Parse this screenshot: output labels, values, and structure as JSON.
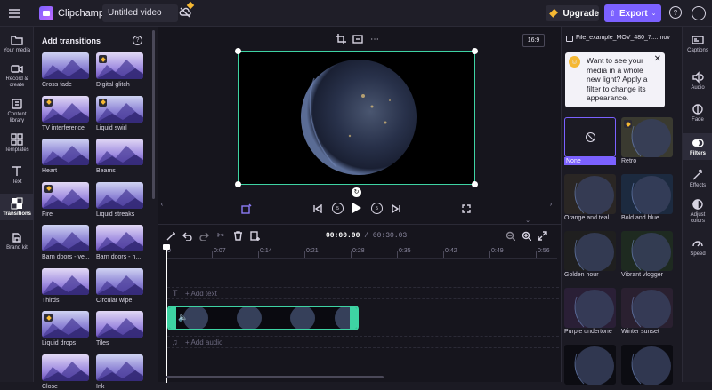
{
  "app": {
    "name": "Clipchamp",
    "project_title": "Untitled video"
  },
  "topbar": {
    "upgrade_label": "Upgrade",
    "export_label": "Export"
  },
  "left_rail": [
    {
      "label": "Your media",
      "icon": "folder-icon"
    },
    {
      "label": "Record & create",
      "icon": "camera-icon"
    },
    {
      "label": "Content library",
      "icon": "library-icon"
    },
    {
      "label": "Templates",
      "icon": "templates-icon"
    },
    {
      "label": "Text",
      "icon": "text-icon"
    },
    {
      "label": "Transitions",
      "icon": "transitions-icon",
      "active": true
    },
    {
      "label": "Brand kit",
      "icon": "brand-kit-icon"
    }
  ],
  "transitions_panel": {
    "title": "Add transitions",
    "items": [
      {
        "label": "Cross fade",
        "premium": false
      },
      {
        "label": "Digital glitch",
        "premium": true
      },
      {
        "label": "TV interference",
        "premium": true
      },
      {
        "label": "Liquid swirl",
        "premium": true
      },
      {
        "label": "Heart",
        "premium": false
      },
      {
        "label": "Beams",
        "premium": false
      },
      {
        "label": "Fire",
        "premium": true
      },
      {
        "label": "Liquid streaks",
        "premium": false
      },
      {
        "label": "Barn doors - ve...",
        "premium": false
      },
      {
        "label": "Barn doors - h...",
        "premium": false
      },
      {
        "label": "Thirds",
        "premium": false
      },
      {
        "label": "Circular wipe",
        "premium": false
      },
      {
        "label": "Liquid drops",
        "premium": true
      },
      {
        "label": "Tiles",
        "premium": false
      },
      {
        "label": "Close",
        "premium": false
      },
      {
        "label": "Ink",
        "premium": false
      }
    ]
  },
  "preview": {
    "aspect_ratio": "16:9"
  },
  "timeline": {
    "current_time": "00:00.00",
    "total_time": "00:30.03",
    "ruler_ticks": [
      "0",
      "0:07",
      "0:14",
      "0:21",
      "0:28",
      "0:35",
      "0:42",
      "0:49",
      "0:56"
    ],
    "add_text_label": "+ Add text",
    "add_audio_label": "+ Add audio"
  },
  "right_panel": {
    "file_name": "File_example_MOV_480_7....mov",
    "tip_text": "Want to see your media in a whole new light? Apply a filter to change its appearance.",
    "filters": [
      {
        "label": "None",
        "selected": true
      },
      {
        "label": "Retro",
        "premium": true
      },
      {
        "label": "Orange and teal"
      },
      {
        "label": "Bold and blue"
      },
      {
        "label": "Golden hour"
      },
      {
        "label": "Vibrant vlogger"
      },
      {
        "label": "Purple undertone"
      },
      {
        "label": "Winter sunset"
      },
      {
        "label": ""
      },
      {
        "label": ""
      }
    ]
  },
  "right_rail": [
    {
      "label": "Captions",
      "icon": "captions-icon"
    },
    {
      "label": "Audio",
      "icon": "speaker-icon"
    },
    {
      "label": "Fade",
      "icon": "fade-icon"
    },
    {
      "label": "Filters",
      "icon": "filters-icon",
      "active": true
    },
    {
      "label": "Effects",
      "icon": "effects-icon"
    },
    {
      "label": "Adjust colors",
      "icon": "adjust-colors-icon"
    },
    {
      "label": "Speed",
      "icon": "speed-icon"
    }
  ],
  "colors": {
    "accent": "#7b61ff",
    "premium": "#f5b833",
    "clip_border": "#3ed3a3"
  }
}
